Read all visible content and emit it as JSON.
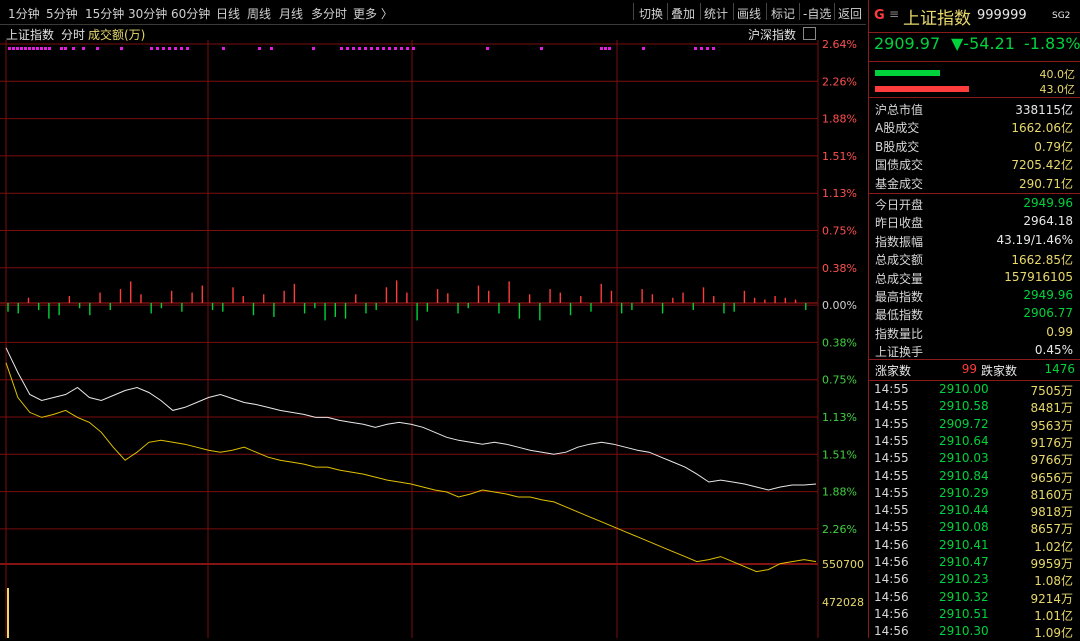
{
  "toolbar": {
    "timeframes": [
      "1分钟",
      "5分钟",
      "15分钟",
      "30分钟",
      "60分钟",
      "日线",
      "周线",
      "月线",
      "多分时",
      "更多 〉"
    ],
    "tools": [
      "切换",
      "叠加",
      "统计",
      "画线",
      "标记",
      "-自选",
      "返回"
    ]
  },
  "chart_header": {
    "index_name": "上证指数",
    "mode": "分时",
    "volume_label": "成交额(万)",
    "market_label": "沪深指数"
  },
  "chart_data": {
    "type": "line",
    "right_axis_labels": [
      "2.64%",
      "2.26%",
      "1.88%",
      "1.51%",
      "1.13%",
      "0.75%",
      "0.38%",
      "0.00%",
      "0.38%",
      "0.75%",
      "1.13%",
      "1.51%",
      "1.88%",
      "2.26%"
    ],
    "volume_axis_labels": [
      "550700",
      "472028"
    ],
    "white_line": [
      -0.45,
      -0.7,
      -0.92,
      -0.98,
      -0.95,
      -0.92,
      -0.85,
      -0.95,
      -0.98,
      -0.93,
      -0.88,
      -0.85,
      -0.9,
      -0.98,
      -1.08,
      -1.05,
      -1.0,
      -0.95,
      -0.92,
      -0.96,
      -1.0,
      -1.02,
      -1.05,
      -1.08,
      -1.1,
      -1.12,
      -1.15,
      -1.15,
      -1.18,
      -1.2,
      -1.22,
      -1.25,
      -1.22,
      -1.2,
      -1.22,
      -1.25,
      -1.3,
      -1.35,
      -1.38,
      -1.4,
      -1.42,
      -1.4,
      -1.42,
      -1.45,
      -1.48,
      -1.5,
      -1.52,
      -1.5,
      -1.45,
      -1.42,
      -1.4,
      -1.42,
      -1.45,
      -1.48,
      -1.5,
      -1.55,
      -1.6,
      -1.65,
      -1.72,
      -1.8,
      -1.78,
      -1.8,
      -1.82,
      -1.85,
      -1.88,
      -1.85,
      -1.83,
      -1.83,
      -1.82
    ],
    "yellow_line": [
      -0.6,
      -0.95,
      -1.1,
      -1.15,
      -1.12,
      -1.08,
      -1.15,
      -1.2,
      -1.3,
      -1.45,
      -1.58,
      -1.5,
      -1.4,
      -1.38,
      -1.4,
      -1.42,
      -1.45,
      -1.48,
      -1.5,
      -1.48,
      -1.45,
      -1.5,
      -1.55,
      -1.58,
      -1.6,
      -1.62,
      -1.65,
      -1.65,
      -1.68,
      -1.7,
      -1.72,
      -1.75,
      -1.78,
      -1.8,
      -1.82,
      -1.85,
      -1.88,
      -1.9,
      -1.95,
      -1.92,
      -1.88,
      -1.9,
      -1.92,
      -1.95,
      -1.95,
      -1.98,
      -2.0,
      -2.05,
      -2.1,
      -2.15,
      -2.2,
      -2.25,
      -2.3,
      -2.35,
      -2.4,
      -2.45,
      -2.5,
      -2.55,
      -2.6,
      -2.58,
      -2.55,
      -2.6,
      -2.65,
      -2.7,
      -2.68,
      -2.62,
      -2.6,
      -2.58,
      -2.6
    ],
    "ratio_bars": [
      -0.25,
      -0.3,
      0.15,
      -0.2,
      -0.45,
      -0.35,
      0.2,
      -0.15,
      -0.35,
      0.3,
      -0.2,
      0.4,
      0.62,
      0.25,
      -0.3,
      -0.15,
      0.35,
      -0.25,
      0.3,
      0.5,
      -0.2,
      -0.25,
      0.45,
      0.2,
      -0.35,
      0.25,
      -0.4,
      0.35,
      0.55,
      -0.3,
      -0.15,
      -0.5,
      -0.4,
      -0.45,
      0.25,
      -0.3,
      -0.2,
      0.45,
      0.65,
      0.3,
      -0.5,
      -0.25,
      0.4,
      0.28,
      -0.3,
      -0.15,
      0.5,
      0.35,
      -0.3,
      0.62,
      -0.45,
      0.25,
      -0.5,
      0.4,
      0.3,
      -0.35,
      0.2,
      -0.25,
      0.55,
      0.35,
      -0.3,
      -0.2,
      0.4,
      0.25,
      -0.3,
      0.15,
      0.3,
      -0.2,
      0.45,
      0.2,
      -0.3,
      -0.25,
      0.35,
      0.15,
      0.1,
      0.2,
      0.15,
      0.1,
      -0.2
    ]
  },
  "quote": {
    "logo": "G",
    "menu_icon": "≡",
    "name": "上证指数",
    "code": "999999",
    "tag": "SG2",
    "price": "2909.97",
    "change": "▼-54.21",
    "change_pct": "-1.83%",
    "buy_amount": "40.0亿",
    "sell_amount": "43.0亿",
    "buy_ratio": 0.48,
    "sell_ratio": 0.52
  },
  "stats_top": [
    {
      "k": "沪总市值",
      "v": "338115亿",
      "c": "white"
    },
    {
      "k": "A股成交",
      "v": "1662.06亿",
      "c": "yellow"
    },
    {
      "k": "B股成交",
      "v": "0.79亿",
      "c": "yellow"
    },
    {
      "k": "国债成交",
      "v": "7205.42亿",
      "c": "yellow"
    },
    {
      "k": "基金成交",
      "v": "290.71亿",
      "c": "yellow"
    }
  ],
  "stats_mid": [
    {
      "k": "今日开盘",
      "v": "2949.96",
      "c": "green"
    },
    {
      "k": "昨日收盘",
      "v": "2964.18",
      "c": "white"
    },
    {
      "k": "指数振幅",
      "v": "43.19/1.46%",
      "c": "white"
    },
    {
      "k": "总成交额",
      "v": "1662.85亿",
      "c": "yellow"
    },
    {
      "k": "总成交量",
      "v": "157916105",
      "c": "yellow"
    },
    {
      "k": "最高指数",
      "v": "2949.96",
      "c": "green"
    },
    {
      "k": "最低指数",
      "v": "2906.77",
      "c": "green"
    },
    {
      "k": "指数量比",
      "v": "0.99",
      "c": "yellow"
    },
    {
      "k": "上证换手",
      "v": "0.45%",
      "c": "white"
    }
  ],
  "breadth": {
    "up_label": "涨家数",
    "up": "99",
    "down_label": "跌家数",
    "down": "1476"
  },
  "ticks": [
    {
      "t": "14:55",
      "p": "2910.00",
      "v": "7505万"
    },
    {
      "t": "14:55",
      "p": "2910.58",
      "v": "8481万"
    },
    {
      "t": "14:55",
      "p": "2909.72",
      "v": "9563万"
    },
    {
      "t": "14:55",
      "p": "2910.64",
      "v": "9176万"
    },
    {
      "t": "14:55",
      "p": "2910.03",
      "v": "9766万"
    },
    {
      "t": "14:55",
      "p": "2910.84",
      "v": "9656万"
    },
    {
      "t": "14:55",
      "p": "2910.29",
      "v": "8160万"
    },
    {
      "t": "14:55",
      "p": "2910.44",
      "v": "9818万"
    },
    {
      "t": "14:55",
      "p": "2910.08",
      "v": "8657万"
    },
    {
      "t": "14:56",
      "p": "2910.41",
      "v": "1.02亿"
    },
    {
      "t": "14:56",
      "p": "2910.47",
      "v": "9959万"
    },
    {
      "t": "14:56",
      "p": "2910.23",
      "v": "1.08亿"
    },
    {
      "t": "14:56",
      "p": "2910.32",
      "v": "9214万"
    },
    {
      "t": "14:56",
      "p": "2910.51",
      "v": "1.01亿"
    },
    {
      "t": "14:56",
      "p": "2910.30",
      "v": "1.09亿"
    }
  ],
  "colors": {
    "up": "#ff3c3c",
    "down": "#00d23c",
    "grid": "#7a0e0e",
    "white_line": "#e8e8e8",
    "yellow_line": "#e0c000",
    "dots": "#e020e0"
  }
}
